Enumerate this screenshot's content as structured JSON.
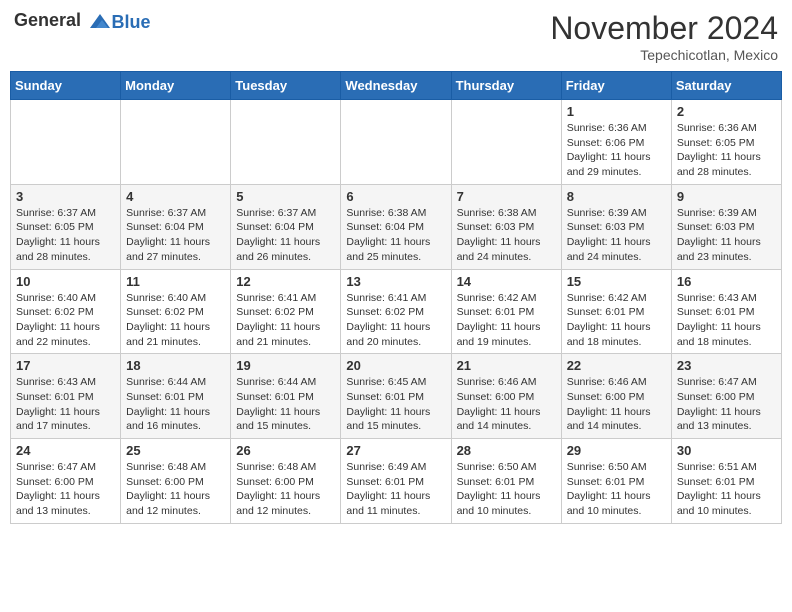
{
  "header": {
    "logo_general": "General",
    "logo_blue": "Blue",
    "month": "November 2024",
    "location": "Tepechicotlan, Mexico"
  },
  "weekdays": [
    "Sunday",
    "Monday",
    "Tuesday",
    "Wednesday",
    "Thursday",
    "Friday",
    "Saturday"
  ],
  "weeks": [
    [
      {
        "day": "",
        "info": ""
      },
      {
        "day": "",
        "info": ""
      },
      {
        "day": "",
        "info": ""
      },
      {
        "day": "",
        "info": ""
      },
      {
        "day": "",
        "info": ""
      },
      {
        "day": "1",
        "info": "Sunrise: 6:36 AM\nSunset: 6:06 PM\nDaylight: 11 hours and 29 minutes."
      },
      {
        "day": "2",
        "info": "Sunrise: 6:36 AM\nSunset: 6:05 PM\nDaylight: 11 hours and 28 minutes."
      }
    ],
    [
      {
        "day": "3",
        "info": "Sunrise: 6:37 AM\nSunset: 6:05 PM\nDaylight: 11 hours and 28 minutes."
      },
      {
        "day": "4",
        "info": "Sunrise: 6:37 AM\nSunset: 6:04 PM\nDaylight: 11 hours and 27 minutes."
      },
      {
        "day": "5",
        "info": "Sunrise: 6:37 AM\nSunset: 6:04 PM\nDaylight: 11 hours and 26 minutes."
      },
      {
        "day": "6",
        "info": "Sunrise: 6:38 AM\nSunset: 6:04 PM\nDaylight: 11 hours and 25 minutes."
      },
      {
        "day": "7",
        "info": "Sunrise: 6:38 AM\nSunset: 6:03 PM\nDaylight: 11 hours and 24 minutes."
      },
      {
        "day": "8",
        "info": "Sunrise: 6:39 AM\nSunset: 6:03 PM\nDaylight: 11 hours and 24 minutes."
      },
      {
        "day": "9",
        "info": "Sunrise: 6:39 AM\nSunset: 6:03 PM\nDaylight: 11 hours and 23 minutes."
      }
    ],
    [
      {
        "day": "10",
        "info": "Sunrise: 6:40 AM\nSunset: 6:02 PM\nDaylight: 11 hours and 22 minutes."
      },
      {
        "day": "11",
        "info": "Sunrise: 6:40 AM\nSunset: 6:02 PM\nDaylight: 11 hours and 21 minutes."
      },
      {
        "day": "12",
        "info": "Sunrise: 6:41 AM\nSunset: 6:02 PM\nDaylight: 11 hours and 21 minutes."
      },
      {
        "day": "13",
        "info": "Sunrise: 6:41 AM\nSunset: 6:02 PM\nDaylight: 11 hours and 20 minutes."
      },
      {
        "day": "14",
        "info": "Sunrise: 6:42 AM\nSunset: 6:01 PM\nDaylight: 11 hours and 19 minutes."
      },
      {
        "day": "15",
        "info": "Sunrise: 6:42 AM\nSunset: 6:01 PM\nDaylight: 11 hours and 18 minutes."
      },
      {
        "day": "16",
        "info": "Sunrise: 6:43 AM\nSunset: 6:01 PM\nDaylight: 11 hours and 18 minutes."
      }
    ],
    [
      {
        "day": "17",
        "info": "Sunrise: 6:43 AM\nSunset: 6:01 PM\nDaylight: 11 hours and 17 minutes."
      },
      {
        "day": "18",
        "info": "Sunrise: 6:44 AM\nSunset: 6:01 PM\nDaylight: 11 hours and 16 minutes."
      },
      {
        "day": "19",
        "info": "Sunrise: 6:44 AM\nSunset: 6:01 PM\nDaylight: 11 hours and 15 minutes."
      },
      {
        "day": "20",
        "info": "Sunrise: 6:45 AM\nSunset: 6:01 PM\nDaylight: 11 hours and 15 minutes."
      },
      {
        "day": "21",
        "info": "Sunrise: 6:46 AM\nSunset: 6:00 PM\nDaylight: 11 hours and 14 minutes."
      },
      {
        "day": "22",
        "info": "Sunrise: 6:46 AM\nSunset: 6:00 PM\nDaylight: 11 hours and 14 minutes."
      },
      {
        "day": "23",
        "info": "Sunrise: 6:47 AM\nSunset: 6:00 PM\nDaylight: 11 hours and 13 minutes."
      }
    ],
    [
      {
        "day": "24",
        "info": "Sunrise: 6:47 AM\nSunset: 6:00 PM\nDaylight: 11 hours and 13 minutes."
      },
      {
        "day": "25",
        "info": "Sunrise: 6:48 AM\nSunset: 6:00 PM\nDaylight: 11 hours and 12 minutes."
      },
      {
        "day": "26",
        "info": "Sunrise: 6:48 AM\nSunset: 6:00 PM\nDaylight: 11 hours and 12 minutes."
      },
      {
        "day": "27",
        "info": "Sunrise: 6:49 AM\nSunset: 6:01 PM\nDaylight: 11 hours and 11 minutes."
      },
      {
        "day": "28",
        "info": "Sunrise: 6:50 AM\nSunset: 6:01 PM\nDaylight: 11 hours and 10 minutes."
      },
      {
        "day": "29",
        "info": "Sunrise: 6:50 AM\nSunset: 6:01 PM\nDaylight: 11 hours and 10 minutes."
      },
      {
        "day": "30",
        "info": "Sunrise: 6:51 AM\nSunset: 6:01 PM\nDaylight: 11 hours and 10 minutes."
      }
    ]
  ]
}
